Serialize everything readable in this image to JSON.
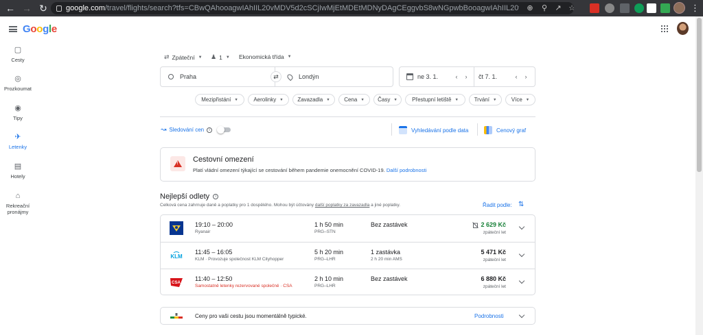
{
  "browser": {
    "url_host": "google.com",
    "url_path": "/travel/flights/search?tfs=CBwQAhooagwIAhIIL20vMDV5d2cSCjIwMjEtMDEtMDNyDAgCEggvbS8wNGpwbBooagwIAhIIL20vMDRqcGwSCjIwMjEtM...",
    "colors": {
      "chrome_bg": "#35363a",
      "omnibox_bg": "#202124"
    }
  },
  "app": {
    "logo_letters": [
      {
        "ch": "G",
        "color": "#4285f4"
      },
      {
        "ch": "o",
        "color": "#ea4335"
      },
      {
        "ch": "o",
        "color": "#fbbc05"
      },
      {
        "ch": "g",
        "color": "#4285f4"
      },
      {
        "ch": "l",
        "color": "#34a853"
      },
      {
        "ch": "e",
        "color": "#ea4335"
      }
    ],
    "accent": "#1a73e8"
  },
  "sidebar": {
    "items": [
      {
        "label": "Cesty",
        "icon": "briefcase-icon"
      },
      {
        "label": "Prozkoumat",
        "icon": "explore-icon"
      },
      {
        "label": "Tipy",
        "icon": "camera-icon"
      },
      {
        "label": "Letenky",
        "icon": "airplane-icon",
        "active": true
      },
      {
        "label": "Hotely",
        "icon": "bed-icon"
      },
      {
        "label": "Rekreační pronájmy",
        "icon": "home-icon"
      }
    ]
  },
  "search": {
    "trip_type": "Zpáteční",
    "passengers": "1",
    "cabin_class": "Ekonomická třída",
    "origin": "Praha",
    "destination": "Londýn",
    "depart_date": "ne 3. 1.",
    "return_date": "čt 7. 1."
  },
  "filters": [
    "Mezipřistání",
    "Aerolinky",
    "Zavazadla",
    "Cena",
    "Časy",
    "Přestupní letiště",
    "Trvání",
    "Více"
  ],
  "tools": {
    "tracking_label": "Sledování cen",
    "date_search": "Vyhledávání podle data",
    "price_graph": "Cenový graf"
  },
  "alert": {
    "title": "Cestovní omezení",
    "text": "Platí vládní omezení týkající se cestování během pandemie onemocnění COVID-19.",
    "link": "Další podrobnosti"
  },
  "results": {
    "title": "Nejlepší odlety",
    "subtitle_pre": "Celková cena zahrnuje daně a poplatky pro 1 dospělého. Mohou být účtovány ",
    "subtitle_link": "další poplatky za zavazadla",
    "subtitle_post": " a jiné poplatky.",
    "sort_label": "Řadit podle:",
    "flights": [
      {
        "times": "19:10 – 20:00",
        "carrier": "Ryanair",
        "duration": "1 h 50 min",
        "route": "PRG–STN",
        "stops": "Bez zastávek",
        "stop_info": "",
        "price": "2 629 Kč",
        "price_type": "zpáteční let",
        "logo": "ryanair-logo"
      },
      {
        "times": "11:45 – 16:05",
        "carrier": "KLM · Provozuje společnost KLM Cityhopper",
        "duration": "5 h 20 min",
        "route": "PRG–LHR",
        "stops": "1 zastávka",
        "stop_info": "2 h 20 min AMS",
        "price": "5 471 Kč",
        "price_type": "zpáteční let",
        "logo": "klm-logo",
        "logo_text": "KLM"
      },
      {
        "times": "11:40 – 12:50",
        "carrier": "Samostatně letenky rezervované společně · CSA",
        "duration": "2 h 10 min",
        "route": "PRG–LHR",
        "stops": "Bez zastávek",
        "stop_info": "",
        "price": "6 880 Kč",
        "price_type": "zpáteční let",
        "logo": "csa-logo",
        "logo_text": "CSA"
      }
    ]
  },
  "insight": {
    "text": "Ceny pro vaši cestu jsou momentálně typické.",
    "link": "Podrobnosti"
  }
}
